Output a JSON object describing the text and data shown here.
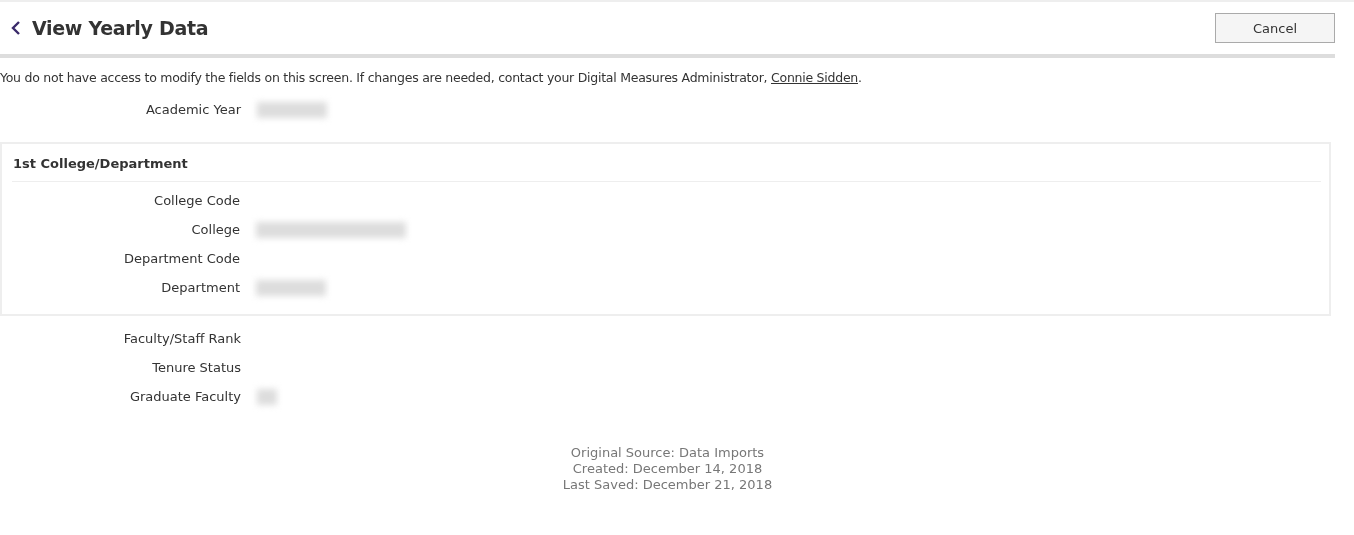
{
  "header": {
    "title": "View Yearly Data",
    "cancel": "Cancel"
  },
  "notice": {
    "text": "You do not have access to modify the fields on this screen. If changes are needed, contact your Digital Measures Administrator, ",
    "link": "Connie Sidden",
    "end": "."
  },
  "fields_top": [
    {
      "label": "Academic Year",
      "redacted": true
    }
  ],
  "section": {
    "title": "1st College/Department",
    "fields": [
      {
        "label": "College Code",
        "redacted": false
      },
      {
        "label": "College",
        "redacted": true
      },
      {
        "label": "Department Code",
        "redacted": false
      },
      {
        "label": "Department",
        "redacted": true
      }
    ]
  },
  "fields_bottom": [
    {
      "label": "Faculty/Staff Rank",
      "redacted": false
    },
    {
      "label": "Tenure Status",
      "redacted": false
    },
    {
      "label": "Graduate Faculty",
      "redacted": true
    }
  ],
  "footer": [
    "Original Source: Data Imports",
    "Created: December 14, 2018",
    "Last Saved: December 21, 2018"
  ]
}
